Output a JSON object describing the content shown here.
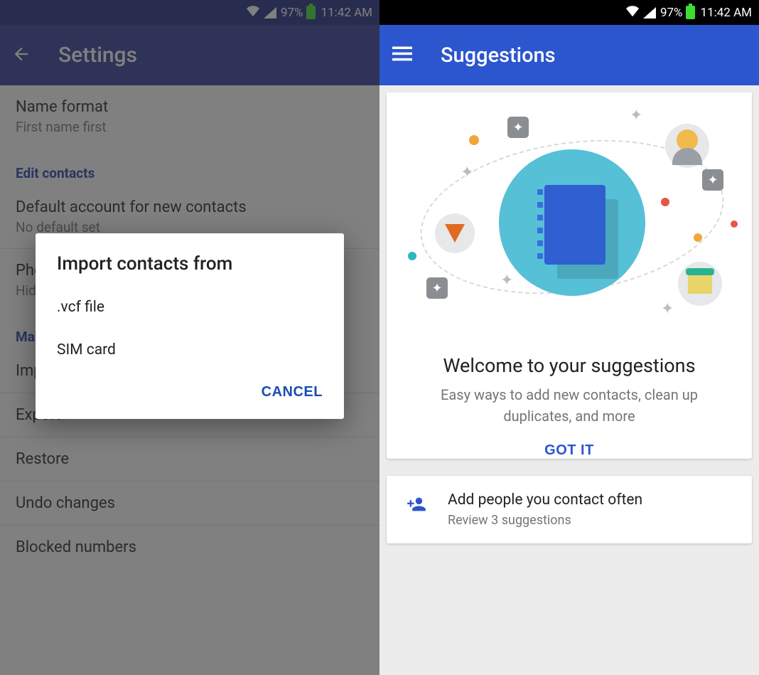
{
  "status": {
    "battery_pct": "97%",
    "time": "11:42 AM"
  },
  "left_screen": {
    "appbar": {
      "title": "Settings"
    },
    "settings": {
      "name_format": {
        "label": "Name format",
        "value": "First name first"
      },
      "section_edit": "Edit contacts",
      "default_account": {
        "label": "Default account for new contacts",
        "value": "No default set"
      },
      "phone": {
        "label": "Phonetic name",
        "value": "Hide if empty"
      },
      "section_manage": "Manage contacts",
      "import": "Import",
      "export": "Export",
      "restore": "Restore",
      "undo": "Undo changes",
      "blocked": "Blocked numbers"
    },
    "dialog": {
      "title": "Import contacts from",
      "opt1": ".vcf file",
      "opt2": "SIM card",
      "cancel": "CANCEL"
    }
  },
  "right_screen": {
    "appbar": {
      "title": "Suggestions"
    },
    "welcome": {
      "title": "Welcome to your suggestions",
      "subtitle": "Easy ways to add new contacts, clean up duplicates, and more",
      "gotit": "GOT IT"
    },
    "add_card": {
      "title": "Add people you contact often",
      "subtitle": "Review 3 suggestions"
    }
  }
}
